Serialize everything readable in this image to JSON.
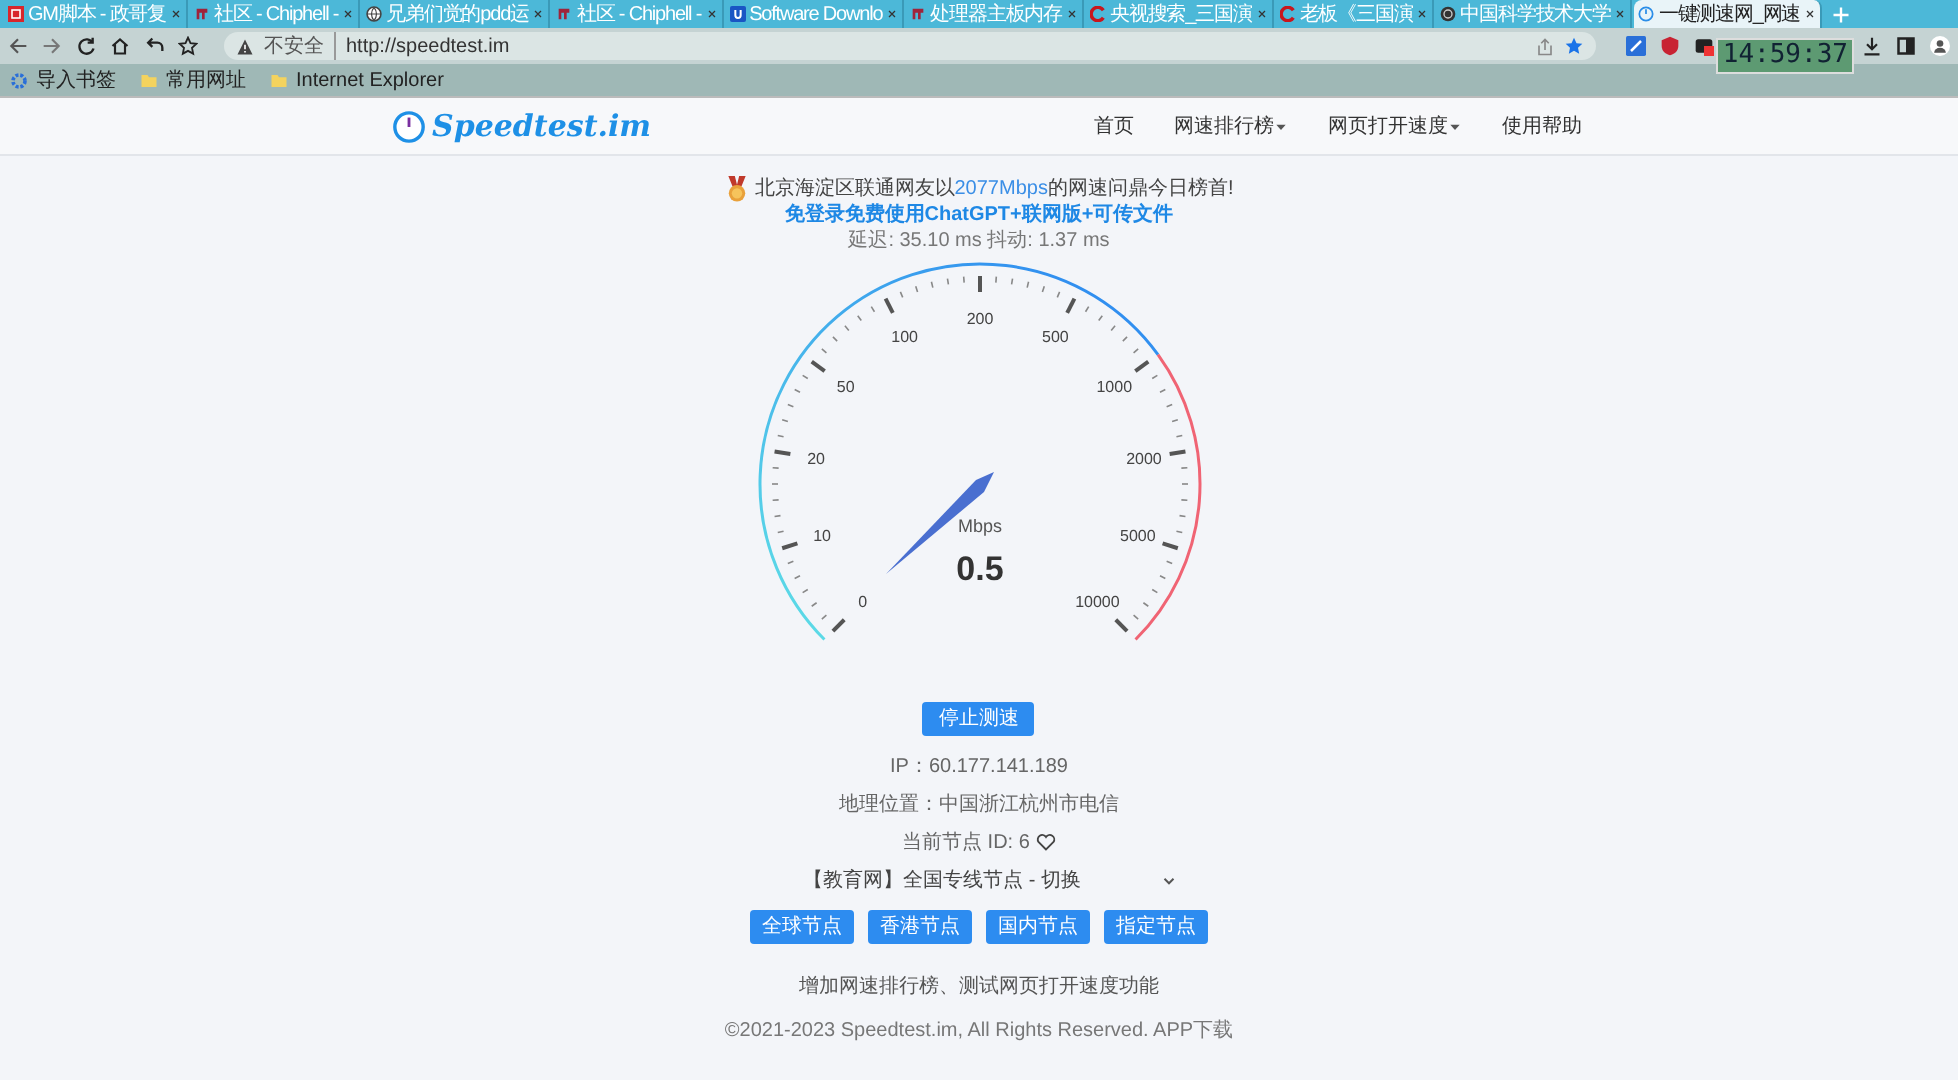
{
  "browser": {
    "tabs": [
      {
        "title": "GM脚本 - 政哥复",
        "kind": "square",
        "selected": false
      },
      {
        "title": "社区 - Chiphell -",
        "kind": "forum",
        "selected": false
      },
      {
        "title": "兄弟们觉的pdd运",
        "kind": "globe",
        "selected": false
      },
      {
        "title": "社区 - Chiphell -",
        "kind": "forum",
        "selected": false
      },
      {
        "title": "Software Downlo",
        "kind": "letter",
        "selected": false
      },
      {
        "title": "处理器主板内存",
        "kind": "forum",
        "selected": false
      },
      {
        "title": "央视搜索_三国演",
        "kind": "arc",
        "selected": false
      },
      {
        "title": "老板《三国演",
        "kind": "arc",
        "selected": false
      },
      {
        "title": "中国科学技术大学",
        "kind": "ring",
        "selected": false
      },
      {
        "title": "一键测速网_网速",
        "kind": "gauge",
        "selected": true
      }
    ],
    "security": "不安全",
    "url": "http://speedtest.im",
    "bookmarks": [
      {
        "label": "导入书签",
        "kind": "import"
      },
      {
        "label": "常用网址",
        "kind": "folder"
      },
      {
        "label": "Internet Explorer",
        "kind": "folder"
      }
    ],
    "clock": "14:59:37"
  },
  "site": {
    "logo": "Speedtest.im",
    "nav": [
      {
        "label": "首页",
        "dropdown": false
      },
      {
        "label": "网速排行榜",
        "dropdown": true
      },
      {
        "label": "网页打开速度",
        "dropdown": true
      },
      {
        "label": "使用帮助",
        "dropdown": false
      }
    ]
  },
  "banner": {
    "before": "北京海淀区联通网友以",
    "highlight": "2077Mbps",
    "after": "的网速问鼎今日榜首!"
  },
  "promo_link": "免登录免费使用ChatGPT+联网版+可传文件",
  "latency": "延迟: 35.10 ms 抖动: 1.37 ms",
  "gauge": {
    "scale": [
      "0",
      "10",
      "20",
      "50",
      "100",
      "200",
      "500",
      "1000",
      "2000",
      "5000",
      "10000"
    ],
    "unit": "Mbps",
    "reading": "0.5"
  },
  "stop_button": "停止测速",
  "info": [
    {
      "text": "IP：60.177.141.189",
      "heart": false
    },
    {
      "text": "地理位置：中国浙江杭州市电信",
      "heart": false
    },
    {
      "text": "当前节点 ID: 6",
      "heart": true
    }
  ],
  "node_select": "【教育网】全国专线节点 - 切换",
  "node_buttons": [
    "全球节点",
    "香港节点",
    "国内节点",
    "指定节点"
  ],
  "notice": "增加网速排行榜、测试网页打开速度功能",
  "footer": "©2021-2023 Speedtest.im, All Rights Reserved. APP下载"
}
